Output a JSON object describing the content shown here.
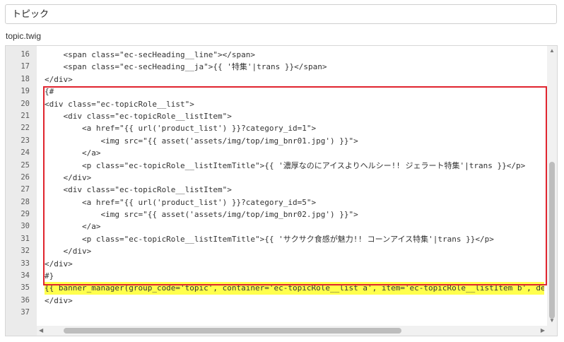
{
  "topic": {
    "value": "トピック"
  },
  "filename": "topic.twig",
  "lines": [
    {
      "n": "16",
      "text": "    <span class=\"ec-secHeading__line\"></span>",
      "hl": false
    },
    {
      "n": "17",
      "text": "    <span class=\"ec-secHeading__ja\">{{ '特集'|trans }}</span>",
      "hl": false
    },
    {
      "n": "18",
      "text": "</div>",
      "hl": false
    },
    {
      "n": "19",
      "text": "{#",
      "hl": false
    },
    {
      "n": "20",
      "text": "<div class=\"ec-topicRole__list\">",
      "hl": false
    },
    {
      "n": "21",
      "text": "    <div class=\"ec-topicRole__listItem\">",
      "hl": false
    },
    {
      "n": "22",
      "text": "        <a href=\"{{ url('product_list') }}?category_id=1\">",
      "hl": false
    },
    {
      "n": "23",
      "text": "            <img src=\"{{ asset('assets/img/top/img_bnr01.jpg') }}\">",
      "hl": false
    },
    {
      "n": "24",
      "text": "        </a>",
      "hl": false
    },
    {
      "n": "25",
      "text": "        <p class=\"ec-topicRole__listItemTitle\">{{ '濃厚なのにアイスよりヘルシー!! ジェラート特集'|trans }}</p>",
      "hl": false
    },
    {
      "n": "26",
      "text": "    </div>",
      "hl": false
    },
    {
      "n": "27",
      "text": "    <div class=\"ec-topicRole__listItem\">",
      "hl": false
    },
    {
      "n": "28",
      "text": "        <a href=\"{{ url('product_list') }}?category_id=5\">",
      "hl": false
    },
    {
      "n": "29",
      "text": "            <img src=\"{{ asset('assets/img/top/img_bnr02.jpg') }}\">",
      "hl": false
    },
    {
      "n": "30",
      "text": "        </a>",
      "hl": false
    },
    {
      "n": "31",
      "text": "        <p class=\"ec-topicRole__listItemTitle\">{{ 'サクサク食感が魅力!! コーンアイス特集'|trans }}</p>",
      "hl": false
    },
    {
      "n": "32",
      "text": "    </div>",
      "hl": false
    },
    {
      "n": "33",
      "text": "</div>",
      "hl": false
    },
    {
      "n": "34",
      "text": "#}",
      "hl": false
    },
    {
      "n": "35",
      "text": "{{ banner_manager(group_code='topic', container='ec-topicRole__list a', item='ec-topicRole__listItem b', des",
      "hl": true
    },
    {
      "n": "36",
      "text": "</div>",
      "hl": false
    },
    {
      "n": "37",
      "text": "",
      "hl": false
    }
  ]
}
